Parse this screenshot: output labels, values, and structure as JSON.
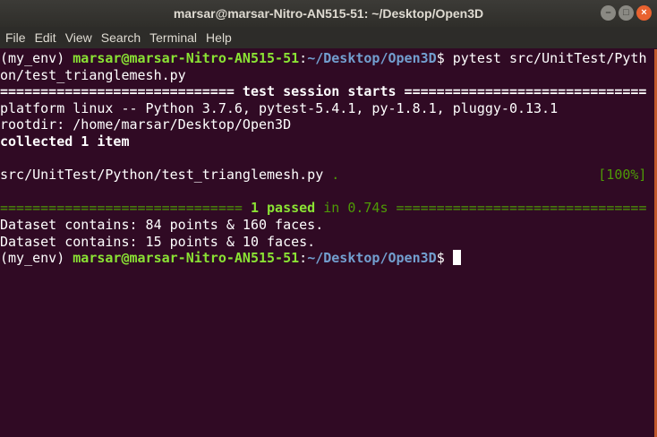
{
  "window": {
    "title": "marsar@marsar-Nitro-AN515-51: ~/Desktop/Open3D",
    "buttons": [
      "–",
      "□",
      "×"
    ]
  },
  "menu": [
    "File",
    "Edit",
    "View",
    "Search",
    "Terminal",
    "Help"
  ],
  "prompt": {
    "env": "(my_env) ",
    "userhost": "marsar@marsar-Nitro-AN515-51",
    "colon": ":",
    "path": "~/Desktop/Open3D",
    "dollar": "$ "
  },
  "command": "pytest src/UnitTest/Python/test_trianglemesh.py",
  "lines": {
    "session": "============================= test session starts ==============================",
    "platform": "platform linux -- Python 3.7.6, pytest-5.4.1, py-1.8.1, pluggy-0.13.1",
    "rootdir": "rootdir: /home/marsar/Desktop/Open3D",
    "collected": "collected 1 item",
    "testfile": "src/UnitTest/Python/test_trianglemesh.py ",
    "dot": ".",
    "pct": "[100%]",
    "eq_left": "============================== ",
    "passed": "1 passed",
    "time": " in 0.74s ",
    "eq_right": "===============================",
    "dataset1": "Dataset contains: 84 points & 160 faces.",
    "dataset2": "Dataset contains: 15 points & 10 faces."
  }
}
